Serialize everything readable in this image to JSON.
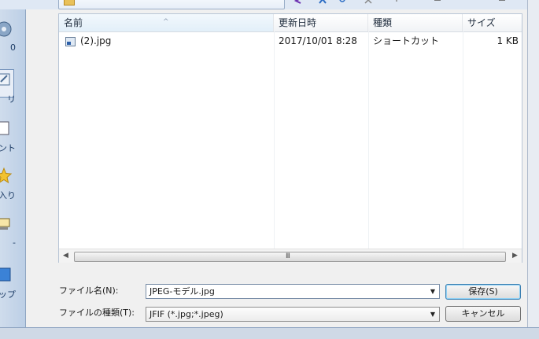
{
  "columns": [
    {
      "label": "名前",
      "sorted": true
    },
    {
      "label": "更新日時"
    },
    {
      "label": "種類"
    },
    {
      "label": "サイズ"
    }
  ],
  "files": [
    {
      "name": "(2).jpg",
      "modified": "2017/10/01 8:28",
      "type": "ショートカット",
      "size": "1 KB"
    }
  ],
  "places": [
    {
      "label": "0"
    },
    {
      "label": "リ"
    },
    {
      "label": "ント"
    },
    {
      "label": "入り"
    },
    {
      "label": "-"
    },
    {
      "label": "ップ"
    }
  ],
  "form": {
    "filename_label": "ファイル名(N):",
    "filename_value": "JPEG-モデル.jpg",
    "filetype_label": "ファイルの種類(T):",
    "filetype_value": "JFIF (*.jpg;*.jpeg)",
    "save_label": "保存(S)",
    "cancel_label": "キャンセル"
  },
  "scrollbar": {
    "grip": "III"
  },
  "colors": {
    "accent": "#3c7fb1",
    "places_bg": "#c4d4e8"
  }
}
